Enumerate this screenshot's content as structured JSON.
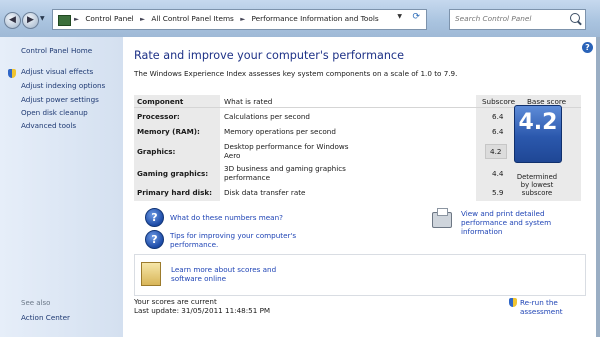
{
  "address_bar": {
    "crumbs": [
      "Control Panel",
      "All Control Panel Items",
      "Performance Information and Tools"
    ]
  },
  "search": {
    "placeholder": "Search Control Panel"
  },
  "left_pane": {
    "home": "Control Panel Home",
    "links": [
      "Adjust visual effects",
      "Adjust indexing options",
      "Adjust power settings",
      "Open disk cleanup",
      "Advanced tools"
    ],
    "see_also_heading": "See also",
    "see_also_link": "Action Center"
  },
  "main": {
    "title": "Rate and improve your computer's performance",
    "description": "The Windows Experience Index assesses key system components on a scale of 1.0 to 7.9.",
    "headers": {
      "component": "Component",
      "rated": "What is rated",
      "subscore": "Subscore",
      "base": "Base score"
    },
    "rows": [
      {
        "component": "Processor:",
        "rated": "Calculations per second",
        "subscore": "6.4"
      },
      {
        "component": "Memory (RAM):",
        "rated": "Memory operations per second",
        "subscore": "6.4"
      },
      {
        "component": "Graphics:",
        "rated": "Desktop performance for Windows Aero",
        "subscore": "4.2"
      },
      {
        "component": "Gaming graphics:",
        "rated": "3D business and gaming graphics performance",
        "subscore": "4.4"
      },
      {
        "component": "Primary hard disk:",
        "rated": "Disk data transfer rate",
        "subscore": "5.9"
      }
    ],
    "base_score": "4.2",
    "base_note": "Determined by lowest subscore",
    "links": {
      "what_numbers": "What do these numbers mean?",
      "tips": "Tips for improving your computer's performance.",
      "print": "View and print detailed performance and system information",
      "learn_more": "Learn more about scores and software online"
    },
    "status": {
      "current": "Your scores are current",
      "last_update": "Last update: 31/05/2011 11:48:51 PM"
    },
    "rerun": "Re-run the assessment"
  }
}
